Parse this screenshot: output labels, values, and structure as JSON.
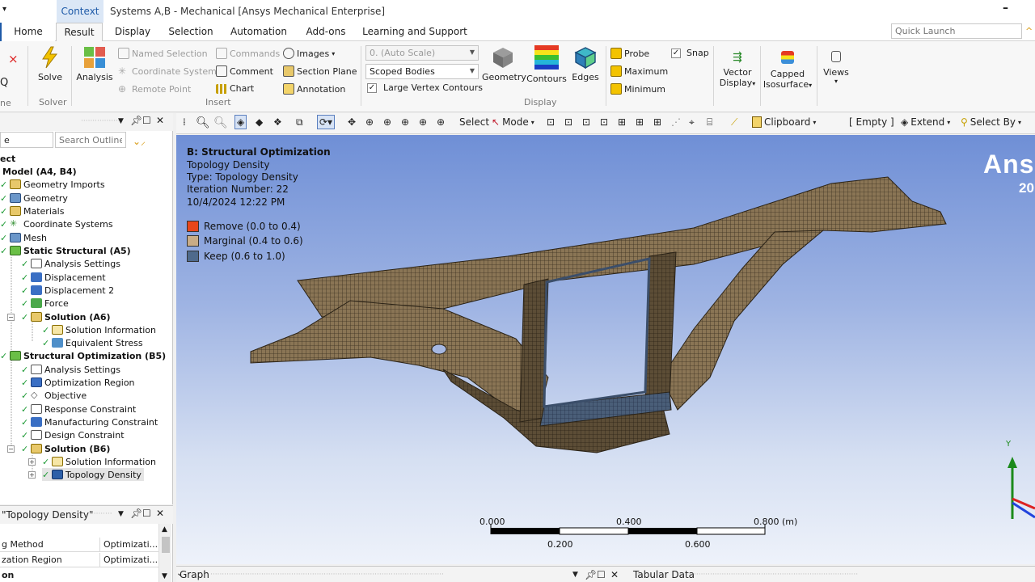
{
  "titlebar": {
    "context_tab": "Context",
    "title": "Systems A,B - Mechanical [Ansys Mechanical Enterprise]",
    "minimize": "–"
  },
  "tabs": [
    "Home",
    "Result",
    "Display",
    "Selection",
    "Automation",
    "Add-ons",
    "Learning and Support"
  ],
  "quick_launch": {
    "placeholder": "Quick Launch"
  },
  "ribbon": {
    "left_cut": {
      "x": "×",
      "q": "Q",
      "ne": "ne",
      "e": "e"
    },
    "solve": {
      "label": "Solve",
      "group": "Solver"
    },
    "analysis": {
      "label": "Analysis"
    },
    "insert": {
      "named_selection": "Named Selection",
      "coordinate_system": "Coordinate System",
      "remote_point": "Remote Point",
      "commands": "Commands",
      "comment": "Comment",
      "chart": "Chart",
      "images": "Images",
      "section_plane": "Section Plane",
      "annotation": "Annotation",
      "group": "Insert"
    },
    "display": {
      "scale_combo": "0. (Auto Scale)",
      "bodies_combo": "Scoped Bodies",
      "large_vertex": "Large Vertex Contours",
      "geometry": "Geometry",
      "contours": "Contours",
      "edges": "Edges",
      "group": "Display"
    },
    "probe": {
      "probe": "Probe",
      "maximum": "Maximum",
      "minimum": "Minimum",
      "snap": "Snap"
    },
    "vector_display": {
      "line1": "Vector",
      "line2": "Display"
    },
    "capped_iso": {
      "line1": "Capped",
      "line2": "Isosurface"
    },
    "views": "Views"
  },
  "toolbar": {
    "select": "Select",
    "mode": "Mode",
    "clipboard": "Clipboard",
    "empty": "[ Empty ]",
    "extend": "Extend",
    "select_by": "Select By"
  },
  "outline": {
    "search_placeholder": "Search Outline",
    "filter_value": "e",
    "items": [
      {
        "label": "ect",
        "bold": true
      },
      {
        "label": "Model (A4, B4)",
        "bold": true
      },
      {
        "label": "Geometry Imports"
      },
      {
        "label": "Geometry"
      },
      {
        "label": "Materials"
      },
      {
        "label": "Coordinate Systems"
      },
      {
        "label": "Mesh"
      },
      {
        "label": "Static Structural (A5)",
        "bold": true
      },
      {
        "label": "Analysis Settings"
      },
      {
        "label": "Displacement"
      },
      {
        "label": "Displacement 2"
      },
      {
        "label": "Force"
      },
      {
        "label": "Solution (A6)",
        "bold": true
      },
      {
        "label": "Solution Information"
      },
      {
        "label": "Equivalent Stress"
      },
      {
        "label": "Structural Optimization (B5)",
        "bold": true
      },
      {
        "label": "Analysis Settings"
      },
      {
        "label": "Optimization Region"
      },
      {
        "label": "Objective"
      },
      {
        "label": "Response Constraint"
      },
      {
        "label": "Manufacturing Constraint"
      },
      {
        "label": "Design Constraint"
      },
      {
        "label": "Solution (B6)",
        "bold": true
      },
      {
        "label": "Solution Information"
      },
      {
        "label": "Topology Density"
      }
    ]
  },
  "details": {
    "title": "\"Topology Density\"",
    "rows": [
      {
        "name": "g Method",
        "value": "Optimizati..."
      },
      {
        "name": "zation Region",
        "value": "Optimizati..."
      },
      {
        "name": "on",
        "value": ""
      }
    ]
  },
  "viewport": {
    "title": "B: Structural Optimization",
    "lines": [
      "Topology Density",
      "Type: Topology Density",
      "Iteration Number: 22",
      "10/4/2024 12:22 PM"
    ],
    "legend": [
      {
        "label": "Remove (0.0 to 0.4)",
        "color": "#e8461a"
      },
      {
        "label": "Marginal (0.4 to 0.6)",
        "color": "#c9ac86"
      },
      {
        "label": "Keep (0.6 to 1.0)",
        "color": "#4f6a8c"
      }
    ],
    "brand": "Ans",
    "brand_year": "20",
    "scale_top": [
      "0.000",
      "0.400",
      "0.800 (m)"
    ],
    "scale_bottom": [
      "0.200",
      "0.600"
    ],
    "axis_y": "Y"
  },
  "bottom": {
    "graph": "Graph",
    "tabular": "Tabular Data"
  },
  "colors": {
    "accent": "#1e5aa8",
    "check": "#1d9a34",
    "mesh": "#6b5a40"
  }
}
